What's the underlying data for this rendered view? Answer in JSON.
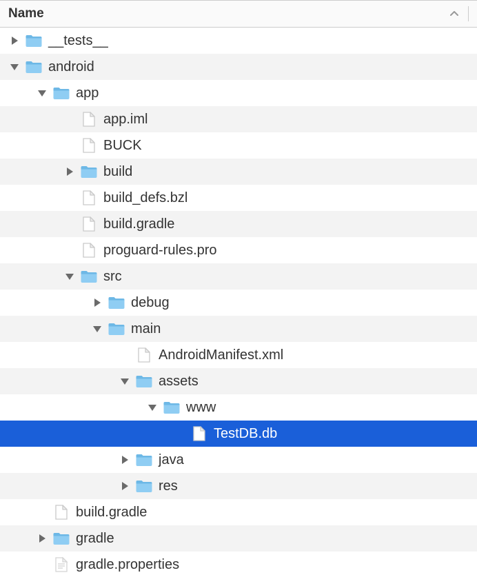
{
  "header": {
    "title": "Name"
  },
  "colors": {
    "folder": "#8fcdf3",
    "folder_dark": "#6db8e6",
    "file_fill": "#ffffff",
    "file_stroke": "#c9c9c9",
    "selection": "#1a5fd9"
  },
  "tree": [
    {
      "depth": 0,
      "type": "folder",
      "state": "closed",
      "label": "__tests__",
      "selected": false
    },
    {
      "depth": 0,
      "type": "folder",
      "state": "open",
      "label": "android",
      "selected": false
    },
    {
      "depth": 1,
      "type": "folder",
      "state": "open",
      "label": "app",
      "selected": false
    },
    {
      "depth": 2,
      "type": "file",
      "state": "none",
      "label": "app.iml",
      "selected": false
    },
    {
      "depth": 2,
      "type": "file",
      "state": "none",
      "label": "BUCK",
      "selected": false
    },
    {
      "depth": 2,
      "type": "folder",
      "state": "closed",
      "label": "build",
      "selected": false
    },
    {
      "depth": 2,
      "type": "file",
      "state": "none",
      "label": "build_defs.bzl",
      "selected": false
    },
    {
      "depth": 2,
      "type": "file",
      "state": "none",
      "label": "build.gradle",
      "selected": false
    },
    {
      "depth": 2,
      "type": "file",
      "state": "none",
      "label": "proguard-rules.pro",
      "selected": false
    },
    {
      "depth": 2,
      "type": "folder",
      "state": "open",
      "label": "src",
      "selected": false
    },
    {
      "depth": 3,
      "type": "folder",
      "state": "closed",
      "label": "debug",
      "selected": false
    },
    {
      "depth": 3,
      "type": "folder",
      "state": "open",
      "label": "main",
      "selected": false
    },
    {
      "depth": 4,
      "type": "file",
      "state": "none",
      "label": "AndroidManifest.xml",
      "selected": false
    },
    {
      "depth": 4,
      "type": "folder",
      "state": "open",
      "label": "assets",
      "selected": false
    },
    {
      "depth": 5,
      "type": "folder",
      "state": "open",
      "label": "www",
      "selected": false
    },
    {
      "depth": 6,
      "type": "file",
      "state": "none",
      "label": "TestDB.db",
      "selected": true
    },
    {
      "depth": 4,
      "type": "folder",
      "state": "closed",
      "label": "java",
      "selected": false
    },
    {
      "depth": 4,
      "type": "folder",
      "state": "closed",
      "label": "res",
      "selected": false
    },
    {
      "depth": 1,
      "type": "file",
      "state": "none",
      "label": "build.gradle",
      "selected": false
    },
    {
      "depth": 1,
      "type": "folder",
      "state": "closed",
      "label": "gradle",
      "selected": false
    },
    {
      "depth": 1,
      "type": "file-text",
      "state": "none",
      "label": "gradle.properties",
      "selected": false
    }
  ]
}
